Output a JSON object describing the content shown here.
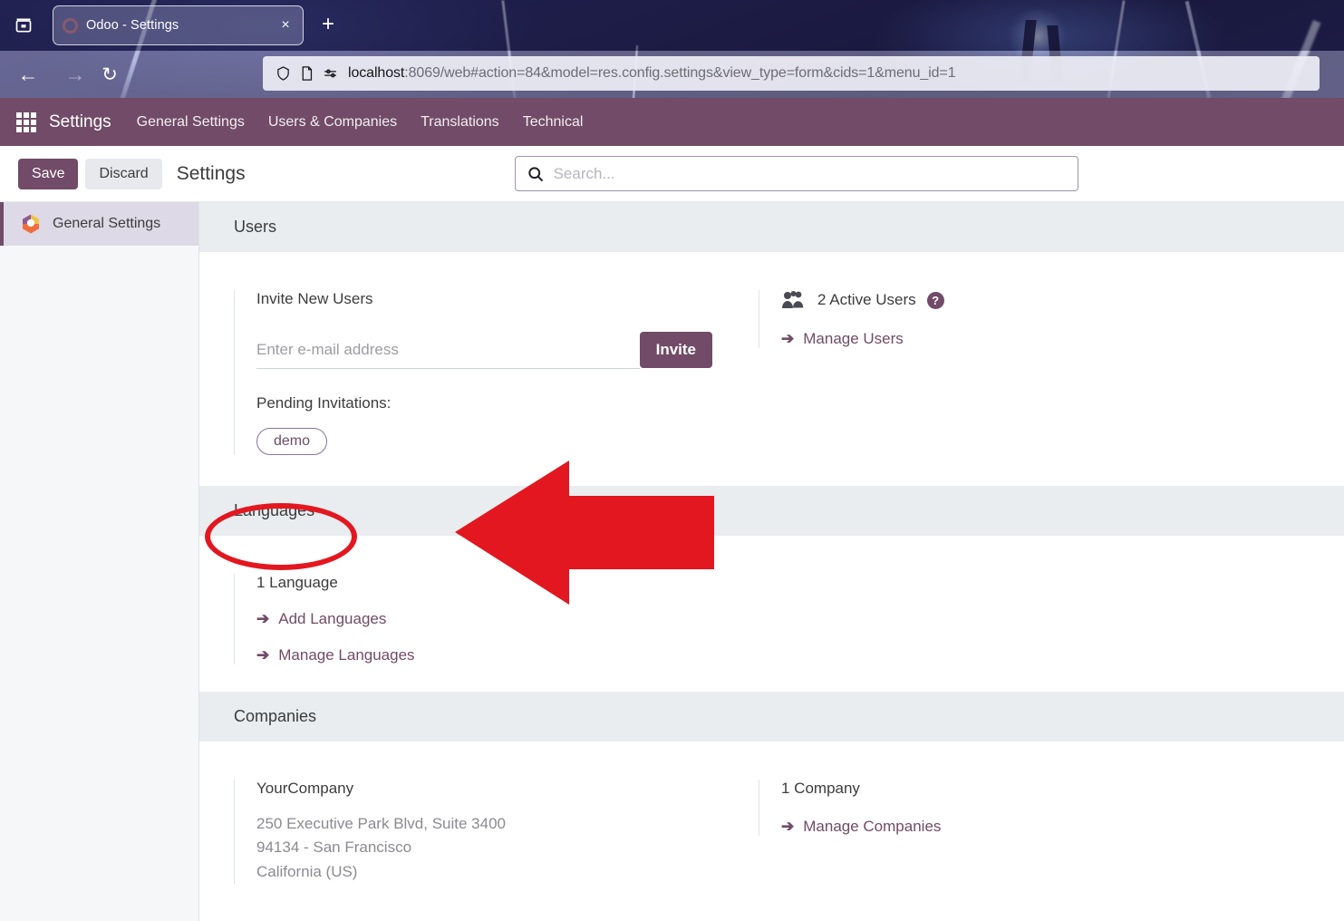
{
  "browser": {
    "tab_list_icon": "tab-list-icon",
    "tab": {
      "title": "Odoo - Settings",
      "close_label": "×",
      "favicon": "odoo-favicon"
    },
    "new_tab_label": "+",
    "back_label": "←",
    "forward_label": "→",
    "reload_label": "↻",
    "url_host": "localhost",
    "url_rest": ":8069/web#action=84&model=res.config.settings&view_type=form&cids=1&menu_id=1",
    "shield_icon": "shield-icon",
    "page-icon": "page-icon",
    "tracking_icon": "tracking-protection-icon"
  },
  "navbar": {
    "apps_icon": "apps-grid-icon",
    "brand": "Settings",
    "menu": [
      {
        "label": "General Settings"
      },
      {
        "label": "Users & Companies"
      },
      {
        "label": "Translations"
      },
      {
        "label": "Technical"
      }
    ]
  },
  "control_panel": {
    "save_label": "Save",
    "discard_label": "Discard",
    "title": "Settings",
    "search_placeholder": "Search...",
    "search_value": "",
    "search_icon": "search-icon"
  },
  "sidebar": {
    "items": [
      {
        "label": "General Settings",
        "icon": "odoo-settings-app-icon",
        "active": true
      }
    ]
  },
  "sections": {
    "users": {
      "header": "Users",
      "invite_title": "Invite New Users",
      "invite_placeholder": "Enter e-mail address",
      "invite_value": "",
      "invite_button": "Invite",
      "pending_label": "Pending Invitations:",
      "pending": [
        "demo"
      ],
      "active_users_text": "2 Active Users",
      "active_users_icon": "users-group-icon",
      "help_icon": "?",
      "manage_users_link": "Manage Users",
      "arrow_glyph": "➔"
    },
    "languages": {
      "header": "Languages",
      "count_text": "1 Language",
      "add_link": "Add Languages",
      "manage_link": "Manage Languages",
      "arrow_glyph": "➔"
    },
    "companies": {
      "header": "Companies",
      "company_name": "YourCompany",
      "address_line1": "250 Executive Park Blvd, Suite 3400",
      "address_line2": "94134 - San Francisco",
      "address_line3": "California (US)",
      "count_text": "1 Company",
      "manage_link": "Manage Companies",
      "arrow_glyph": "➔"
    }
  },
  "annotations": {
    "highlight_color": "#e3171f",
    "ellipse_target": "Languages",
    "arrow_direction": "left",
    "arrow_target": "Languages"
  },
  "colors": {
    "odoo_primary": "#714b67",
    "section_header_bg": "#e9edf0",
    "sidebar_active_bg": "#ded9e6",
    "annotation_red": "#e3171f"
  }
}
